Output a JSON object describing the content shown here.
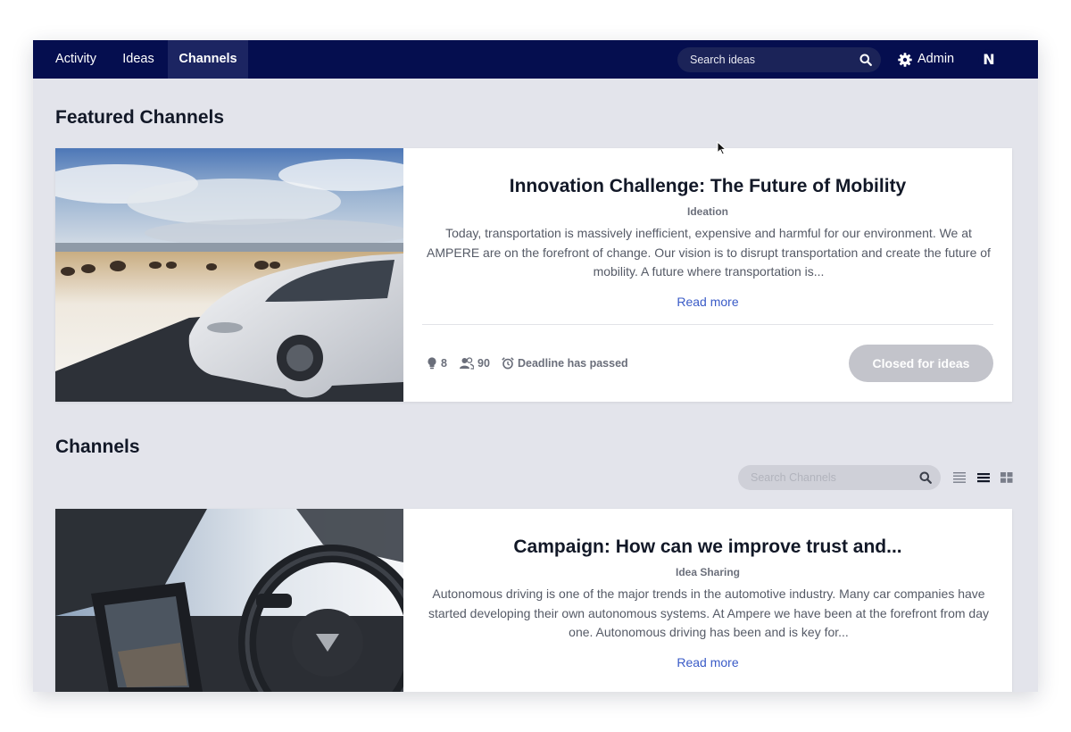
{
  "nav": {
    "tabs": [
      {
        "label": "Activity",
        "active": false
      },
      {
        "label": "Ideas",
        "active": false
      },
      {
        "label": "Channels",
        "active": true
      }
    ],
    "search_placeholder": "Search ideas",
    "admin_label": "Admin",
    "avatar_letter": "N",
    "icons": {
      "search": "search-icon",
      "admin": "gear-icon"
    }
  },
  "featured": {
    "heading": "Featured Channels",
    "card": {
      "title": "Innovation Challenge: The Future of Mobility",
      "type": "Ideation",
      "description": "Today, transportation is massively inefficient, expensive and harmful for our environment. We at AMPERE are on the forefront of change. Our vision is to disrupt transportation and create the future of mobility. A future where transportation is...",
      "read_more": "Read more",
      "stats": {
        "ideas": "8",
        "participants": "90",
        "deadline": "Deadline has passed"
      },
      "status_button": "Closed for ideas",
      "image": "white electric car on snowy road with bison herd"
    }
  },
  "channels": {
    "heading": "Channels",
    "search_placeholder": "Search Channels",
    "view_options": [
      "list-compact-icon",
      "list-icon",
      "grid-icon"
    ],
    "active_view": "list-icon",
    "cards": [
      {
        "title": "Campaign: How can we improve trust and...",
        "type": "Idea Sharing",
        "description": "Autonomous driving is one of the major trends in the automotive industry. Many car companies have started developing their own autonomous systems. At Ampere we have been at the forefront from day one. Autonomous driving has been and is key for...",
        "read_more": "Read more",
        "image": "car interior with steering wheel and touchscreen"
      }
    ]
  },
  "colors": {
    "navbar": "#050e4f",
    "navbar_active": "#1c2562",
    "background": "#e3e4eb",
    "link": "#3a5bc7",
    "disabled_button": "#c3c4cb"
  }
}
